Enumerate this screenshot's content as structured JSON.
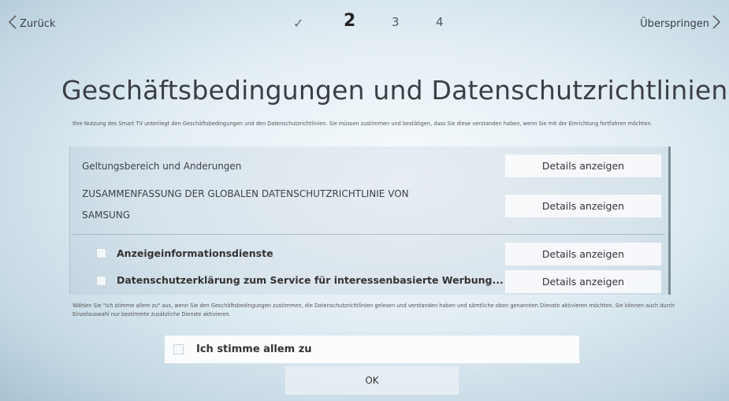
{
  "nav": {
    "back_label": "Zurück",
    "skip_label": "Überspringen",
    "steps": [
      "✓",
      "2",
      "3",
      "4"
    ]
  },
  "page": {
    "title": "Geschäftsbedingungen und Datenschutzrichtlinien",
    "intro": "Ihre Nutzung des Smart TV unterliegt den Geschäftsbedingungen und den Datenschutzrichtlinien. Sie müssen zustimmen und bestätigen, dass Sie diese verstanden haben, wenn Sie mit der Einrichtung fortfahren möchten."
  },
  "terms": {
    "items": [
      {
        "label": "Geltungsbereich und Anderungen",
        "details_label": "Details anzeigen"
      },
      {
        "label_line1": "ZUSAMMENFASSUNG DER GLOBALEN DATENSCHUTZRICHTLINIE VON",
        "label_line2": "SAMSUNG",
        "details_label": "Details anzeigen"
      }
    ],
    "optional_items": [
      {
        "label": "Anzeigeinformationsdienste",
        "details_label": "Details anzeigen",
        "checked": false
      },
      {
        "label": "Datenschutzerklärung zum Service für interessenbasierte Werbung...",
        "details_label": "Details anzeigen",
        "checked": false
      }
    ]
  },
  "footer": {
    "note": "Wählen Sie \"Ich stimme allem zu\" aus, wenn Sie den Geschäftsbedingungen zustimmen, die Datenschutzrichtlinien gelesen und verstanden haben und sämtliche oben genannten Dienste aktivieren möchten. Sie können auch durch Einzelauswahl nur bestimmte zusätzliche Dienste aktivieren.",
    "agree_all_label": "Ich stimme allem zu",
    "agree_all_checked": false,
    "ok_label": "OK"
  }
}
